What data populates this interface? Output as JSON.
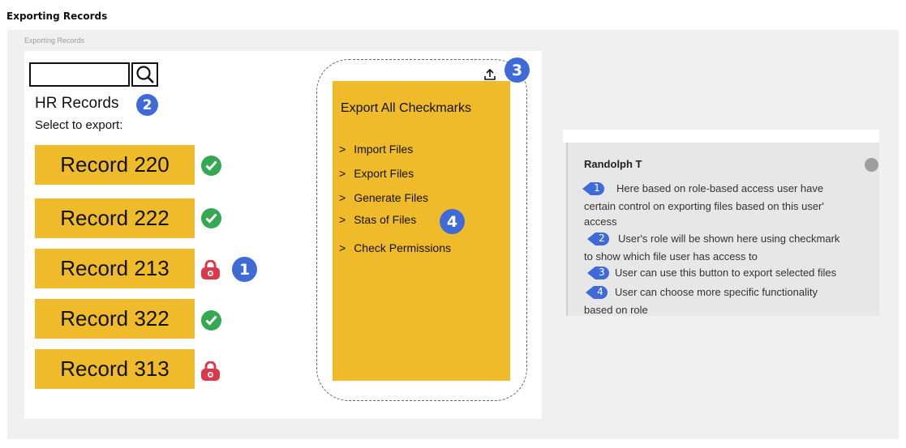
{
  "page": {
    "title": "Exporting Records",
    "canvas_label": "Exporting Records"
  },
  "screen": {
    "search": {
      "value": "",
      "placeholder": ""
    },
    "title": "HR Records",
    "subtitle": "Select to export:",
    "records": [
      {
        "label": "Record 220",
        "status": "checkmark",
        "access": "allowed"
      },
      {
        "label": "Record 222",
        "status": "checkmark",
        "access": "allowed"
      },
      {
        "label": "Record 213",
        "status": "lock",
        "access": "restricted"
      },
      {
        "label": "Record 322",
        "status": "checkmark",
        "access": "allowed"
      },
      {
        "label": "Record 313",
        "status": "lock",
        "access": "restricted"
      }
    ],
    "export_icon": "upload-icon",
    "menu": {
      "heading": "Export All Checkmarks",
      "items": [
        {
          "chevron": ">",
          "label": "Import Files"
        },
        {
          "chevron": ">",
          "label": "Export Files"
        },
        {
          "chevron": ">",
          "label": "Generate Files"
        },
        {
          "chevron": ">",
          "label": "Stas of Files"
        },
        {
          "chevron": ">",
          "label": "Check Permissions"
        }
      ]
    }
  },
  "annotations": {
    "badge_1": "1",
    "badge_2": "2",
    "badge_3": "3",
    "badge_4": "4"
  },
  "comment": {
    "author": "Randolph T",
    "notes": [
      {
        "number": "1",
        "lines": [
          "Here based on role-based access user have",
          "certain control on exporting files based on this user'",
          "access"
        ]
      },
      {
        "number": "2",
        "lines": [
          "User's role will be shown here using checkmark",
          "to show which file user has access to"
        ]
      },
      {
        "number": "3",
        "lines": [
          "User can use this button to export selected files"
        ]
      },
      {
        "number": "4",
        "lines": [
          "User can choose more specific functionality",
          "based on role"
        ]
      }
    ]
  },
  "colors": {
    "record_bg": "#f0bb2a",
    "badge": "#3f6bd9",
    "check": "#34a853",
    "lock": "#d9394a",
    "comment_bg": "#e7e7e7"
  }
}
